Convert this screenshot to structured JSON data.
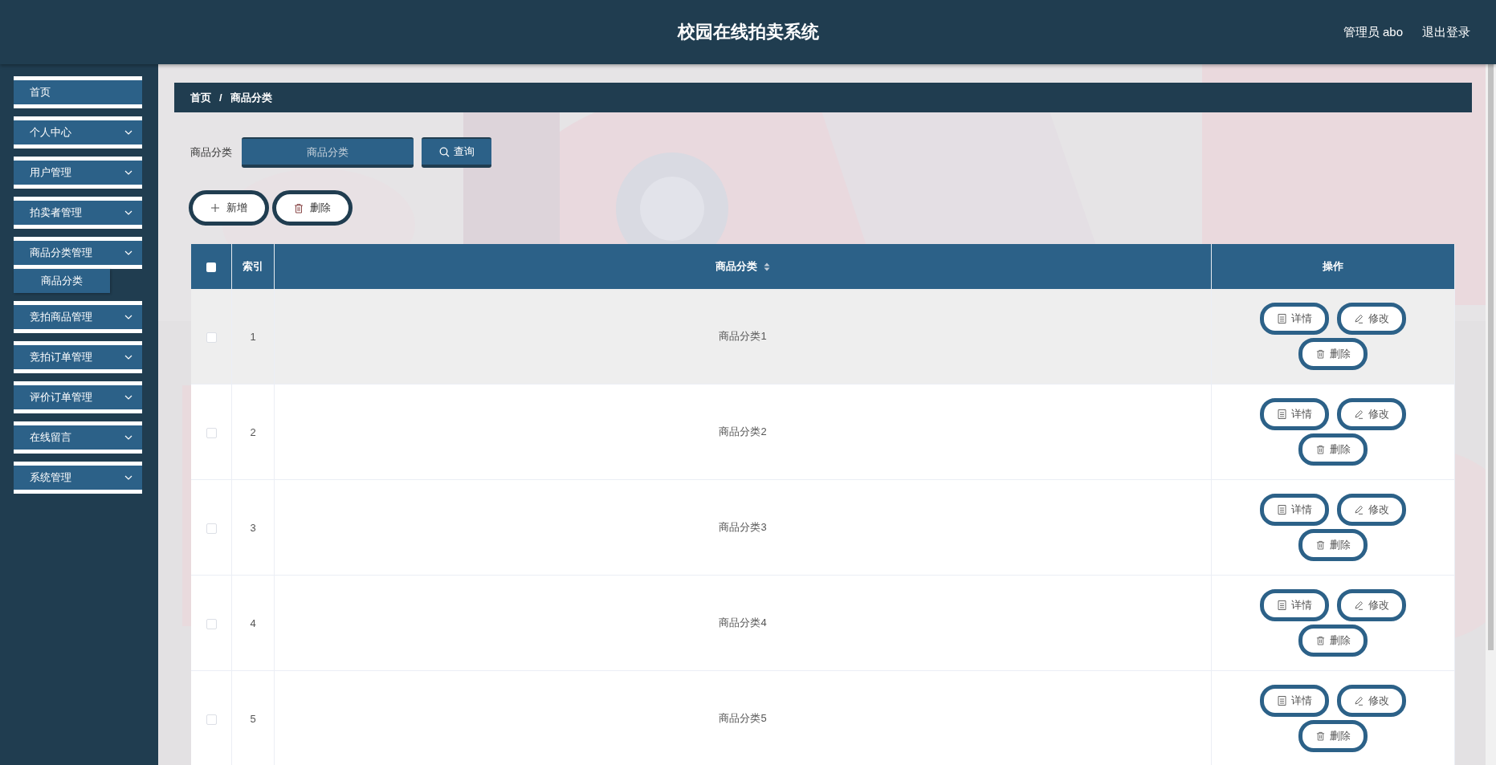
{
  "header": {
    "title": "校园在线拍卖系统",
    "user": "管理员 abo",
    "logout": "退出登录"
  },
  "sidebar": {
    "items": [
      {
        "label": "首页",
        "expandable": false
      },
      {
        "label": "个人中心",
        "expandable": true,
        "expanded": false
      },
      {
        "label": "用户管理",
        "expandable": true,
        "expanded": false
      },
      {
        "label": "拍卖者管理",
        "expandable": true,
        "expanded": false
      },
      {
        "label": "商品分类管理",
        "expandable": true,
        "expanded": true,
        "children": [
          {
            "label": "商品分类"
          }
        ]
      },
      {
        "label": "竞拍商品管理",
        "expandable": true,
        "expanded": false
      },
      {
        "label": "竞拍订单管理",
        "expandable": true,
        "expanded": false
      },
      {
        "label": "评价订单管理",
        "expandable": true,
        "expanded": false
      },
      {
        "label": "在线留言",
        "expandable": true,
        "expanded": false
      },
      {
        "label": "系统管理",
        "expandable": true,
        "expanded": false
      }
    ]
  },
  "breadcrumb": [
    "首页",
    "商品分类"
  ],
  "breadcrumb_separator": "/",
  "search": {
    "label": "商品分类",
    "placeholder": "商品分类",
    "button": "查询"
  },
  "actions": [
    {
      "kind": "add",
      "label": "新增"
    },
    {
      "kind": "delete",
      "label": "删除"
    }
  ],
  "table": {
    "columns": [
      "索引",
      "商品分类",
      "操作"
    ],
    "header_checked": false,
    "rows": [
      {
        "index": "1",
        "category": "商品分类1",
        "checked": false,
        "highlighted": true,
        "actions": [
          {
            "kind": "detail",
            "label": "详情"
          },
          {
            "kind": "edit",
            "label": "修改"
          },
          {
            "kind": "delete",
            "label": "删除"
          }
        ]
      },
      {
        "index": "2",
        "category": "商品分类2",
        "checked": false,
        "highlighted": false,
        "actions": [
          {
            "kind": "detail",
            "label": "详情"
          },
          {
            "kind": "edit",
            "label": "修改"
          },
          {
            "kind": "delete",
            "label": "删除"
          }
        ]
      },
      {
        "index": "3",
        "category": "商品分类3",
        "checked": false,
        "highlighted": false,
        "actions": [
          {
            "kind": "detail",
            "label": "详情"
          },
          {
            "kind": "edit",
            "label": "修改"
          },
          {
            "kind": "delete",
            "label": "删除"
          }
        ]
      },
      {
        "index": "4",
        "category": "商品分类4",
        "checked": false,
        "highlighted": false,
        "actions": [
          {
            "kind": "detail",
            "label": "详情"
          },
          {
            "kind": "edit",
            "label": "修改"
          },
          {
            "kind": "delete",
            "label": "删除"
          }
        ]
      },
      {
        "index": "5",
        "category": "商品分类5",
        "checked": false,
        "highlighted": false,
        "actions": [
          {
            "kind": "detail",
            "label": "详情"
          },
          {
            "kind": "edit",
            "label": "修改"
          },
          {
            "kind": "delete",
            "label": "删除"
          }
        ]
      }
    ]
  }
}
